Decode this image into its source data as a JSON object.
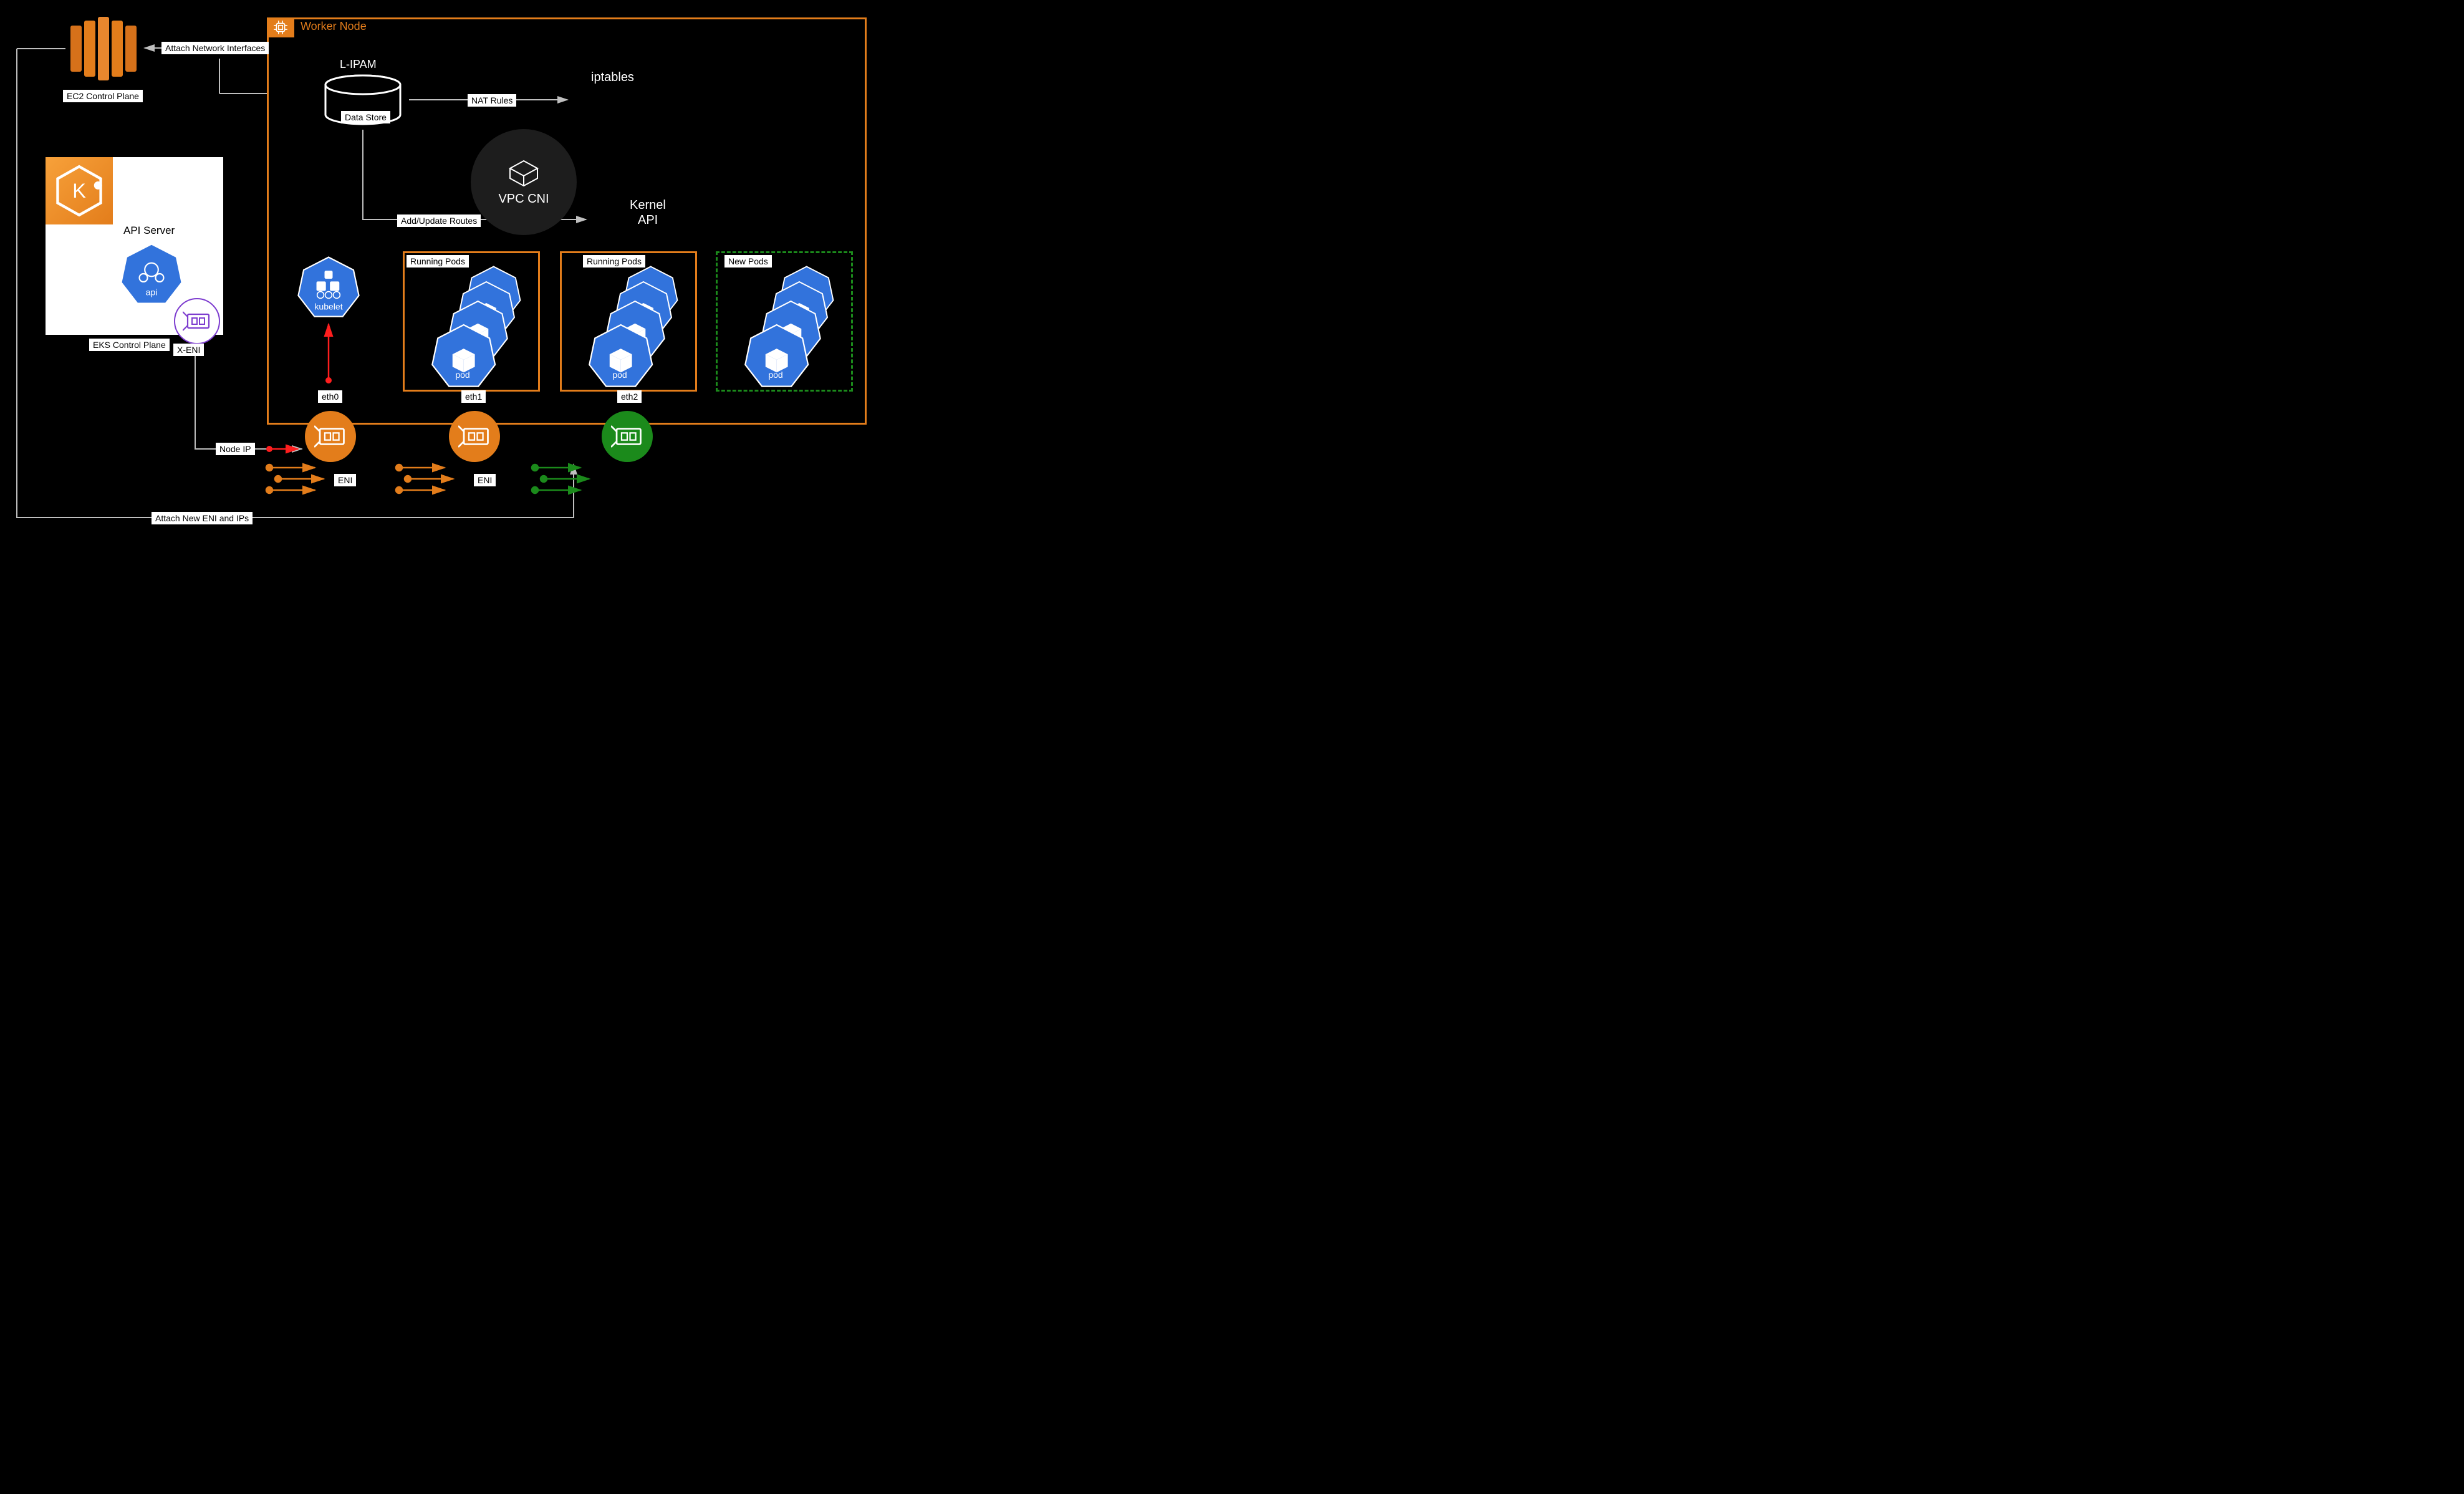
{
  "worker_node": "Worker Node",
  "ec2_control_plane": "EC2 Control Plane",
  "attach_eni_label": "Attach Network Interfaces",
  "lipam_title": "L-IPAM",
  "lipam_sub": "Data Store",
  "nat_rules": "NAT Rules",
  "iptables": "iptables",
  "vpc_cni": "VPC CNI",
  "add_routes": "Add/Update Routes",
  "kernel_api1": "Kernel",
  "kernel_api2": "API",
  "api_server": "API Server",
  "api_label": "api",
  "kubelet_label": "kubelet",
  "eks_control_plane": "EKS Control Plane",
  "xeni": "X-ENI",
  "pod_label": "pod",
  "running_pods_1": "Running Pods",
  "running_pods_2": "Running Pods",
  "new_pods": "New Pods",
  "eth0": "eth0",
  "eth1": "eth1",
  "eth2": "eth2",
  "node_ip": "Node IP",
  "eni1": "ENI",
  "eni2": "ENI",
  "attach_new": "Attach New ENI and IPs",
  "colors": {
    "orange": "#E37D1B",
    "green": "#1B8A1B",
    "blue": "#3273DC",
    "purple": "#7D3CCF",
    "red": "#FF1E1E"
  }
}
